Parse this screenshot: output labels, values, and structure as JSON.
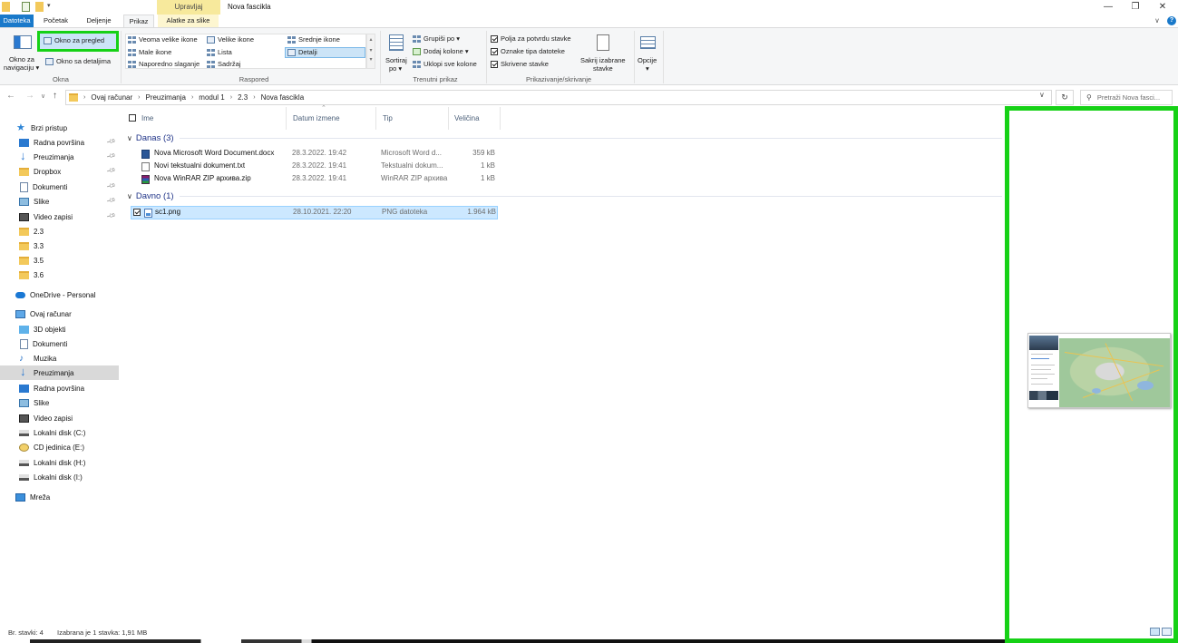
{
  "titlebar": {
    "context_tab_label": "Upravljaj",
    "window_title": "Nova fascikla",
    "minimize": "—",
    "maximize": "❐",
    "close": "✕"
  },
  "tabs": {
    "file": "Datoteka",
    "home": "Početak",
    "share": "Deljenje",
    "view": "Prikaz",
    "picture_tools": "Alatke za slike",
    "expand": "∨",
    "help": "?"
  },
  "ribbon": {
    "panes": {
      "nav_pane_line1": "Okno za",
      "nav_pane_line2": "navigaciju ▾",
      "preview_pane": "Okno za pregled",
      "details_pane": "Okno sa detaljima",
      "group_label": "Okna"
    },
    "layout": {
      "extra_large_icons": "Veoma velike ikone",
      "large_icons": "Velike ikone",
      "medium_icons": "Srednje ikone",
      "small_icons": "Male ikone",
      "list": "Lista",
      "details": "Detalji",
      "tiles": "Naporedno slaganje",
      "content": "Sadržaj",
      "group_label": "Raspored"
    },
    "current_view": {
      "sort_line1": "Sortiraj",
      "sort_line2": "po ▾",
      "group_by": "Grupiši po ▾",
      "add_columns": "Dodaj kolone ▾",
      "size_columns": "Uklopi sve kolone",
      "group_label": "Trenutni prikaz"
    },
    "show_hide": {
      "item_checkboxes": "Polja za potvrdu stavke",
      "file_extensions": "Oznake tipa datoteke",
      "hidden_items": "Skrivene stavke",
      "hide_selected_line1": "Sakrij izabrane",
      "hide_selected_line2": "stavke",
      "group_label": "Prikazivanje/skrivanje"
    },
    "options_line1": "Opcije",
    "options_line2": "▾"
  },
  "address": {
    "crumbs": [
      "Ovaj računar",
      "Preuzimanja",
      "modul 1",
      "2.3",
      "Nova fascikla"
    ],
    "search_placeholder": "Pretraži Nova fasci..."
  },
  "nav": {
    "quick_access": "Brzi pristup",
    "quick_items": [
      "Radna površina",
      "Preuzimanja",
      "Dropbox",
      "Dokumenti",
      "Slike",
      "Video zapisi",
      "2.3",
      "3.3",
      "3.5",
      "3.6"
    ],
    "onedrive": "OneDrive - Personal",
    "this_pc": "Ovaj računar",
    "pc_items": [
      "3D objekti",
      "Dokumenti",
      "Muzika",
      "Preuzimanja",
      "Radna površina",
      "Slike",
      "Video zapisi",
      "Lokalni disk (C:)",
      "CD jedinica (E:)",
      "Lokalni disk (H:)",
      "Lokalni disk (I:)"
    ],
    "network": "Mreža"
  },
  "columns": {
    "name": "Ime",
    "date": "Datum izmene",
    "type": "Tip",
    "size": "Veličina"
  },
  "groups": [
    {
      "header": "Danas (3)",
      "files": [
        {
          "name": "Nova Microsoft Word Document.docx",
          "date": "28.3.2022. 19:42",
          "type": "Microsoft Word d...",
          "size": "359 kB",
          "icon": "word-icon"
        },
        {
          "name": "Novi tekstualni dokument.txt",
          "date": "28.3.2022. 19:41",
          "type": "Tekstualni dokum...",
          "size": "1 kB",
          "icon": "text-file-icon"
        },
        {
          "name": "Nova WinRAR ZIP архива.zip",
          "date": "28.3.2022. 19:41",
          "type": "WinRAR ZIP архива",
          "size": "1 kB",
          "icon": "winrar-icon"
        }
      ]
    },
    {
      "header": "Davno (1)",
      "files": [
        {
          "name": "sc1.png",
          "date": "28.10.2021. 22:20",
          "type": "PNG datoteka",
          "size": "1.964 kB",
          "icon": "png-icon",
          "selected": true
        }
      ]
    }
  ],
  "status": {
    "count": "Br. stavki: 4",
    "selection": "Izabrana je 1 stavka: 1,91 MB"
  },
  "colors": {
    "accent": "#1979ca",
    "highlight_green": "#16d116",
    "selection": "#cce8ff"
  }
}
